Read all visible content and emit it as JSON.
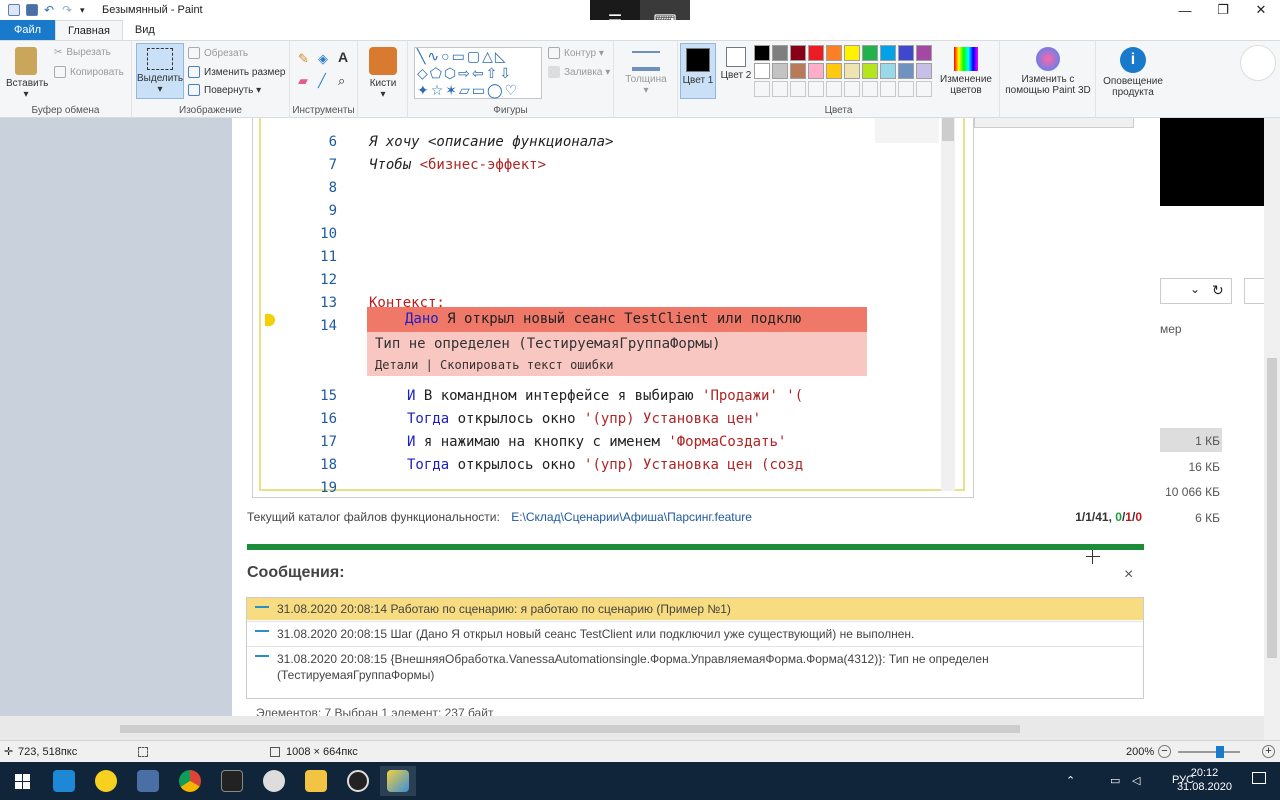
{
  "window": {
    "title": "Безымянный - Paint",
    "min": "—",
    "max": "❐",
    "close": "✕"
  },
  "tablet": {
    "menu_icon": "☰",
    "keyboard_icon": "⌨"
  },
  "tabs": [
    {
      "label": "Файл"
    },
    {
      "label": "Главная"
    },
    {
      "label": "Вид"
    }
  ],
  "ribbon": {
    "clipboard": {
      "paste": "Вставить",
      "cut": "Вырезать",
      "copy": "Копировать",
      "label": "Буфер обмена"
    },
    "image": {
      "select": "Выделить",
      "crop": "Обрезать",
      "resize": "Изменить размер",
      "rotate": "Повернуть ▾",
      "label": "Изображение"
    },
    "tools": {
      "label": "Инструменты"
    },
    "brushes": {
      "label": "Кисти"
    },
    "shapes": {
      "outline": "Контур ▾",
      "fill": "Заливка ▾",
      "label": "Фигуры"
    },
    "thickness": {
      "label": "Толщина"
    },
    "colors": {
      "color1": "Цвет 1",
      "color2": "Цвет 2",
      "edit": "Изменение цветов",
      "label": "Цвета",
      "palette": [
        "#000000",
        "#7f7f7f",
        "#880015",
        "#ed1c24",
        "#ff7f27",
        "#fff200",
        "#22b14c",
        "#00a2e8",
        "#3f48cc",
        "#a349a4",
        "#ffffff",
        "#c3c3c3",
        "#b97a57",
        "#ffaec9",
        "#ffc90e",
        "#efe4b0",
        "#b5e61d",
        "#99d9ea",
        "#7092be",
        "#c8bfe7"
      ]
    },
    "paint3d": "Изменить с помощью Paint 3D",
    "notify": "Оповещение продукта"
  },
  "editor": {
    "lines": [
      {
        "num": "6",
        "code": "Я хочу <описание функционала>"
      },
      {
        "num": "7",
        "code": "Чтобы ",
        "code2": "<бизнес-эффект>"
      },
      {
        "num": "8",
        "code": ""
      },
      {
        "num": "9",
        "code": ""
      },
      {
        "num": "10",
        "code": ""
      },
      {
        "num": "11",
        "code": ""
      },
      {
        "num": "12",
        "code": ""
      },
      {
        "num": "13",
        "code": "Контекст:"
      },
      {
        "num": "14",
        "code": ""
      },
      {
        "num": "15",
        "kw": "И",
        "code": " В командном интерфейсе я выбираю ",
        "str": "'Продажи' '("
      },
      {
        "num": "16",
        "kw": "Тогда",
        "code": " открылось окно ",
        "str": "'(упр) Установка цен'"
      },
      {
        "num": "17",
        "kw": "И",
        "code": " я нажимаю на кнопку с именем ",
        "str": "'ФормаСоздать'"
      },
      {
        "num": "18",
        "kw": "Тогда",
        "code": " открылось окно ",
        "str": "'(упр) Установка цен (созд"
      },
      {
        "num": "19",
        "code": ""
      }
    ],
    "error_step_kw": "Дано",
    "error_step": " Я открыл новый сеанс TestClient или подклю",
    "error_text": "Тип не определен (ТестируемаяГруппаФормы)",
    "error_links": "Детали | Скопировать текст ошибки"
  },
  "catalog": {
    "label": "Текущий каталог файлов функциональности:",
    "path": "E:\\Склад\\Сценарии\\Афиша\\Парсинг.feature",
    "counts_a": "1/1/41, ",
    "counts_b": "0",
    "counts_c": "/",
    "counts_d": "1",
    "counts_e": "/",
    "counts_f": "0"
  },
  "messages": {
    "title": "Сообщения:",
    "close": "×",
    "items": [
      "31.08.2020 20:08:14 Работаю по сценарию: я работаю по сценарию (Пример №1)",
      "31.08.2020 20:08:15 Шаг (Дано Я открыл новый сеанс TestClient или подключил уже существующий) не выполнен.",
      "31.08.2020 20:08:15 {ВнешняяОбработка.VanessaAutomationsingle.Форма.УправляемаяФорма.Форма(4312)}: Тип не определен (ТестируемаяГруппаФормы)"
    ]
  },
  "bottom_partial": "Элементов: 7     Выбран 1 элемент: 237 байт",
  "rightwin": {
    "col_header": "мер",
    "sizes": [
      "1 КБ",
      "16 КБ",
      "10 066 КБ",
      "6 КБ"
    ]
  },
  "statusbar": {
    "position": "723, 518пкс",
    "size": "1008 × 664пкс",
    "zoom": "200%"
  },
  "tray": {
    "lang": "РУС",
    "time": "20:12",
    "date": "31.08.2020"
  }
}
